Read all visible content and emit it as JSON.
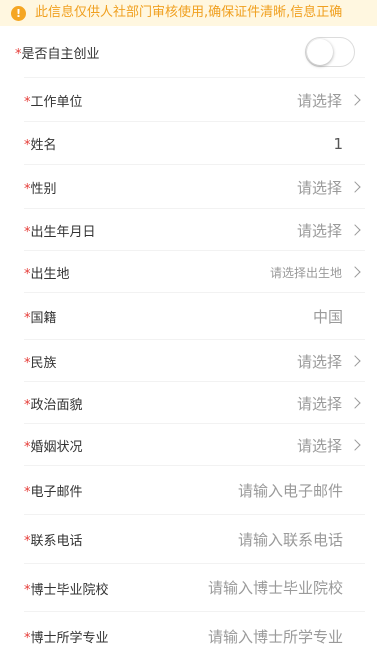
{
  "notice": {
    "icon": "info-icon",
    "icon_glyph": "!",
    "text": "此信息仅供人社部门审核使用,确保证件清晰,信息正确"
  },
  "self_employed": {
    "label": "是否自主创业",
    "required": "*",
    "enabled": false
  },
  "fields": {
    "work_unit": {
      "label": "工作单位",
      "required": "*",
      "value": "请选择"
    },
    "name": {
      "label": "姓名",
      "required": "*",
      "value": "1"
    },
    "gender": {
      "label": "性别",
      "required": "*",
      "value": "请选择"
    },
    "birth_date": {
      "label": "出生年月日",
      "required": "*",
      "value": "请选择"
    },
    "birthplace": {
      "label": "出生地",
      "required": "*",
      "value": "请选择出生地"
    },
    "nationality": {
      "label": "国籍",
      "required": "*",
      "value": "中国"
    },
    "ethnicity": {
      "label": "民族",
      "required": "*",
      "value": "请选择"
    },
    "political": {
      "label": "政治面貌",
      "required": "*",
      "value": "请选择"
    },
    "marital": {
      "label": "婚姻状况",
      "required": "*",
      "value": "请选择"
    },
    "email": {
      "label": "电子邮件",
      "required": "*",
      "placeholder": "请输入电子邮件",
      "value": ""
    },
    "phone": {
      "label": "联系电话",
      "required": "*",
      "placeholder": "请输入联系电话",
      "value": ""
    },
    "phd_school": {
      "label": "博士毕业院校",
      "required": "*",
      "placeholder": "请输入博士毕业院校",
      "value": ""
    },
    "phd_major": {
      "label": "博士所学专业",
      "required": "*",
      "placeholder": "请输入博士所学专业",
      "value": ""
    }
  },
  "colors": {
    "accent": "#f5a623",
    "notice_bg": "#fff7e0",
    "required": "#e53935",
    "placeholder": "#9a9a9a"
  }
}
